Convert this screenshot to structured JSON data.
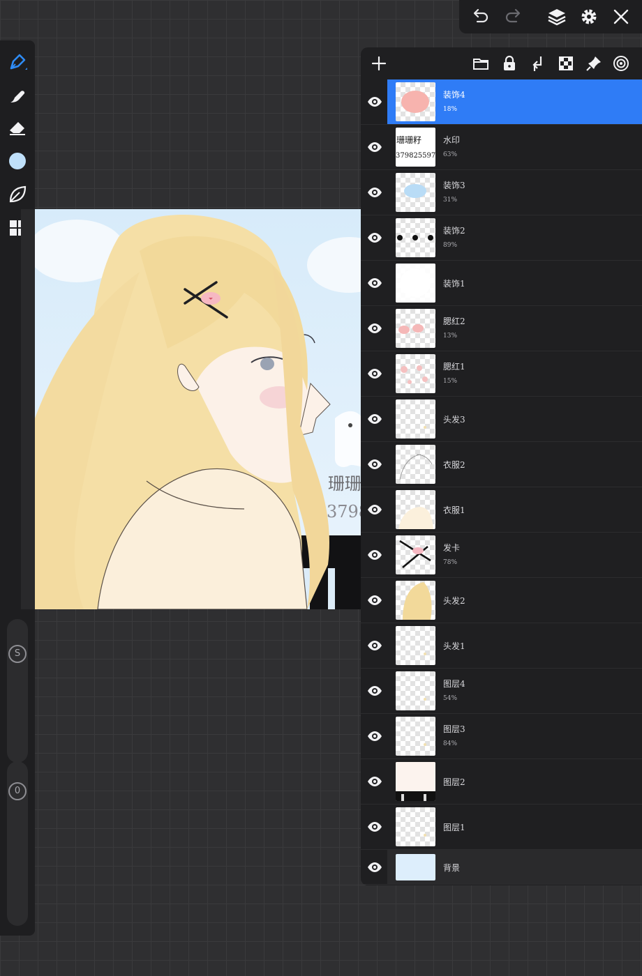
{
  "toolbar": {
    "icons": [
      "undo-icon",
      "redo-icon",
      "layers-icon",
      "gear-icon",
      "close-icon"
    ]
  },
  "rail": {
    "tools": [
      "pen-icon",
      "smudge-icon",
      "eraser-icon",
      "color-swatch",
      "leaf-icon",
      "gallery-icon"
    ],
    "brush_color": "#bfe0fa",
    "size_slider_label": "S",
    "opacity_slider_label": "0"
  },
  "canvas": {
    "watermark_line1": "珊珊",
    "watermark_line2": "3798"
  },
  "layers_panel": {
    "header_icons": [
      "plus-icon",
      "folder-icon",
      "lock-icon",
      "merge-down-icon",
      "alpha-icon",
      "pin-icon",
      "target-icon"
    ],
    "layers": [
      {
        "name": "装饰4",
        "opacity": "18%",
        "active": true,
        "thumb": "pink-blob"
      },
      {
        "name": "水印",
        "opacity": "63%",
        "thumb": "watermark"
      },
      {
        "name": "装饰3",
        "opacity": "31%",
        "thumb": "blue-blob"
      },
      {
        "name": "装饰2",
        "opacity": "89%",
        "thumb": "dots"
      },
      {
        "name": "装饰1",
        "opacity": "",
        "thumb": "white-blob"
      },
      {
        "name": "腮红2",
        "opacity": "13%",
        "thumb": "blush"
      },
      {
        "name": "腮红1",
        "opacity": "15%",
        "thumb": "blush2"
      },
      {
        "name": "头发3",
        "opacity": "",
        "thumb": "empty"
      },
      {
        "name": "衣服2",
        "opacity": "",
        "thumb": "lines"
      },
      {
        "name": "衣服1",
        "opacity": "",
        "thumb": "cloth"
      },
      {
        "name": "发卡",
        "opacity": "78%",
        "thumb": "clip"
      },
      {
        "name": "头发2",
        "opacity": "",
        "thumb": "hair"
      },
      {
        "name": "头发1",
        "opacity": "",
        "thumb": "empty"
      },
      {
        "name": "图层4",
        "opacity": "54%",
        "thumb": "empty"
      },
      {
        "name": "图层3",
        "opacity": "84%",
        "thumb": "empty"
      },
      {
        "name": "图层2",
        "opacity": "",
        "thumb": "fence"
      },
      {
        "name": "图层1",
        "opacity": "",
        "thumb": "empty"
      },
      {
        "name": "背景",
        "opacity": "",
        "thumb": "bg",
        "bg": true
      }
    ],
    "watermark_thumb_line1": "珊珊籽",
    "watermark_thumb_line2": "379825597"
  }
}
